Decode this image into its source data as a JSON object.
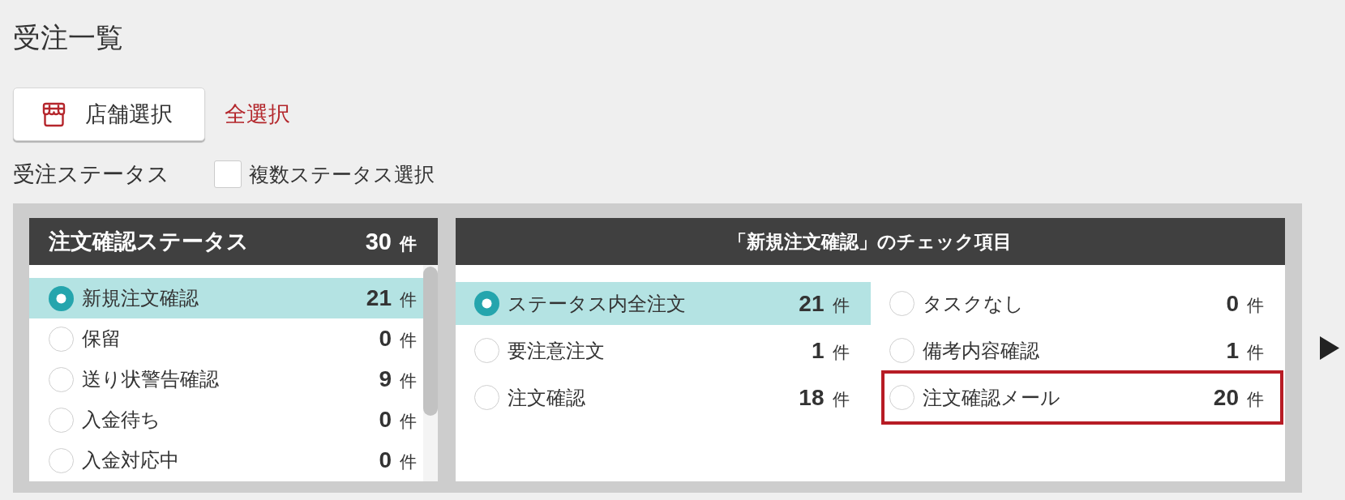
{
  "page": {
    "title": "受注一覧"
  },
  "store_select": {
    "button_label": "店舗選択",
    "select_all": "全選択"
  },
  "status_filter": {
    "label": "受注ステータス",
    "multi_select": {
      "label": "複数ステータス選択",
      "checked": false
    }
  },
  "status_panel": {
    "title": "注文確認ステータス",
    "total": "30",
    "total_unit": "件",
    "items": [
      {
        "label": "新規注文確認",
        "count": "21",
        "unit": "件",
        "selected": true
      },
      {
        "label": "保留",
        "count": "0",
        "unit": "件",
        "selected": false
      },
      {
        "label": "送り状警告確認",
        "count": "9",
        "unit": "件",
        "selected": false
      },
      {
        "label": "入金待ち",
        "count": "0",
        "unit": "件",
        "selected": false
      },
      {
        "label": "入金対応中",
        "count": "0",
        "unit": "件",
        "selected": false
      }
    ]
  },
  "check_panel": {
    "title": "「新規注文確認」のチェック項目",
    "columns": [
      {
        "items": [
          {
            "label": "ステータス内全注文",
            "count": "21",
            "unit": "件",
            "selected": true,
            "highlighted": false
          },
          {
            "label": "要注意注文",
            "count": "1",
            "unit": "件",
            "selected": false,
            "highlighted": false
          },
          {
            "label": "注文確認",
            "count": "18",
            "unit": "件",
            "selected": false,
            "highlighted": false
          }
        ]
      },
      {
        "items": [
          {
            "label": "タスクなし",
            "count": "0",
            "unit": "件",
            "selected": false,
            "highlighted": false
          },
          {
            "label": "備考内容確認",
            "count": "1",
            "unit": "件",
            "selected": false,
            "highlighted": false
          },
          {
            "label": "注文確認メール",
            "count": "20",
            "unit": "件",
            "selected": false,
            "highlighted": true
          }
        ]
      }
    ]
  }
}
